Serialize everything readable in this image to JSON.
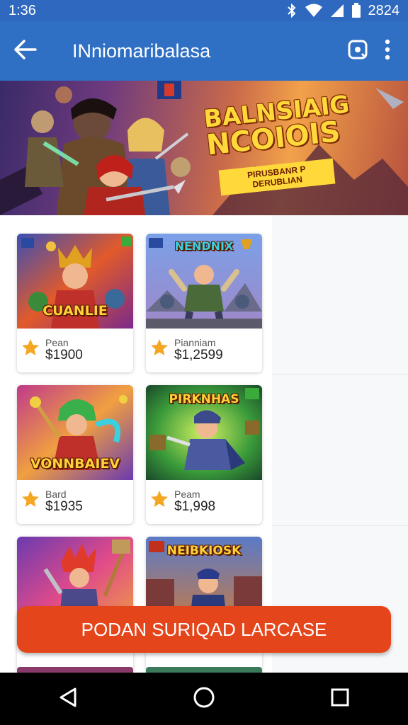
{
  "status_bar": {
    "time": "1:36",
    "right_text": "2824"
  },
  "app_bar": {
    "title": "INniomaribalasa"
  },
  "banner": {
    "title_line1": "BALNSIAIG",
    "title_line2": "NCOIOIS",
    "subtitle": "PIRUSBANR P DERUBLIAN"
  },
  "cards": [
    {
      "art_title": "CUANLIE",
      "name": "Pean",
      "price": "$1900",
      "theme": "#e0552c"
    },
    {
      "art_title": "NENDNIX",
      "name": "Pianniam",
      "price": "$1,2599",
      "theme": "#5b79c4"
    },
    {
      "art_title": "VONNBAIEV",
      "name": "Bard",
      "price": "$1935",
      "theme": "#8a3fb0"
    },
    {
      "art_title": "PIRKNHAS",
      "name": "Peam",
      "price": "$1,998",
      "theme": "#3f8f3f"
    },
    {
      "art_title": "",
      "name": "",
      "price": "",
      "theme": "#9b3a9a"
    },
    {
      "art_title": "NEIBKIOSK",
      "name": "",
      "price": "",
      "theme": "#d0702c"
    }
  ],
  "cta": {
    "label": "PODAN SURIQAD LARCASE",
    "color": "#e5451a"
  },
  "colors": {
    "app_bar": "#2f6fc4",
    "status_bar": "#2f68bf",
    "star": "#f5a623"
  },
  "icons": {
    "back": "arrow-left-icon",
    "screenshot": "camera-frame-icon",
    "more": "more-vertical-icon",
    "nav_back": "triangle-back-icon",
    "nav_home": "circle-home-icon",
    "nav_recent": "square-recent-icon"
  }
}
